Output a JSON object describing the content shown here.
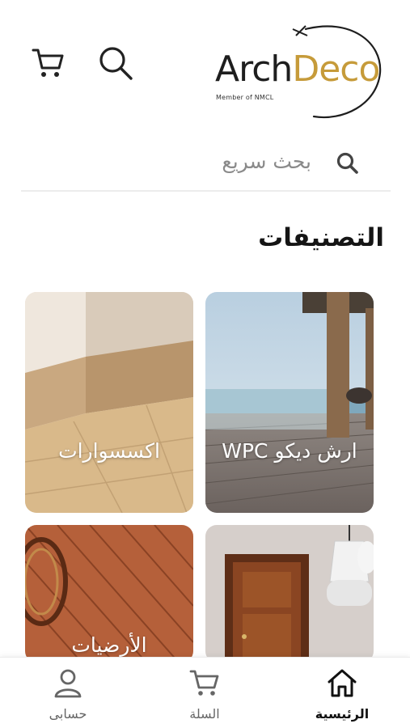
{
  "header": {
    "logo_primary": "Arch",
    "logo_secondary": "Deco",
    "logo_tagline": "Member of NMCL",
    "cart_icon": "cart-icon",
    "search_icon": "search-icon"
  },
  "search": {
    "placeholder": "بحث سريع",
    "icon": "search-icon"
  },
  "categories": {
    "title": "التصنيفات",
    "items": [
      {
        "label": "ارش ديكو WPC",
        "image": "wpc-deck-photo"
      },
      {
        "label": "اكسسوارات",
        "image": "skirting-board-photo"
      },
      {
        "label": "",
        "image": "wooden-door-photo"
      },
      {
        "label": "الأرضيات",
        "image": "wood-floor-photo"
      }
    ]
  },
  "bottom_nav": {
    "items": [
      {
        "label": "الرئيسية",
        "icon": "home-icon",
        "active": true
      },
      {
        "label": "السلة",
        "icon": "cart-icon",
        "active": false
      },
      {
        "label": "حسابى",
        "icon": "user-icon",
        "active": false
      }
    ]
  },
  "colors": {
    "brand_gold": "#c69b3a",
    "text_dark": "#151515",
    "muted": "#8a8a8a"
  }
}
